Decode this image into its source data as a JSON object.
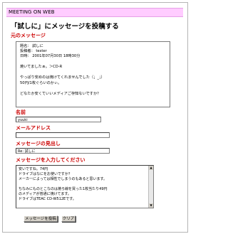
{
  "header": {
    "title": "MEETING ON WEB"
  },
  "page_title": "「試しに」にメッセージを投稿する",
  "original_message": {
    "label": "元のメッセージ",
    "lines": [
      "題名： 試しに",
      "投稿者： tester",
      "日時： 2001年07月30日 18時30分",
      "",
      "焼いてましたぁ。＞CD-R",
      "",
      "やっぱり安めのは焼けてくれませんでした（；_；）",
      "50円/1枚ぐらいのかぃ。",
      "",
      "どなたか安くていいメディアご存知ないですか？"
    ]
  },
  "form": {
    "name_label": "名前",
    "name_value": "yuuki",
    "email_label": "メールアドレス",
    "email_value": "",
    "subject_label": "メッセージの見出し",
    "subject_value": "Re: 試しに",
    "message_label": "メッセージを入力してください",
    "message_lines": [
      "安いですね。74円",
      "ドライブはなにをお使いですか？",
      "メーカーによっては相性でしまうのもあると思います。",
      "",
      "ちなみにものとこなのは焼ろ線を買った1枚当たり49円",
      "のメディアが普通に焼けてます。",
      "ドライブはTEAC CD-W512Eです。"
    ]
  },
  "buttons": {
    "submit": "メッセージを投稿",
    "clear": "クリア"
  }
}
